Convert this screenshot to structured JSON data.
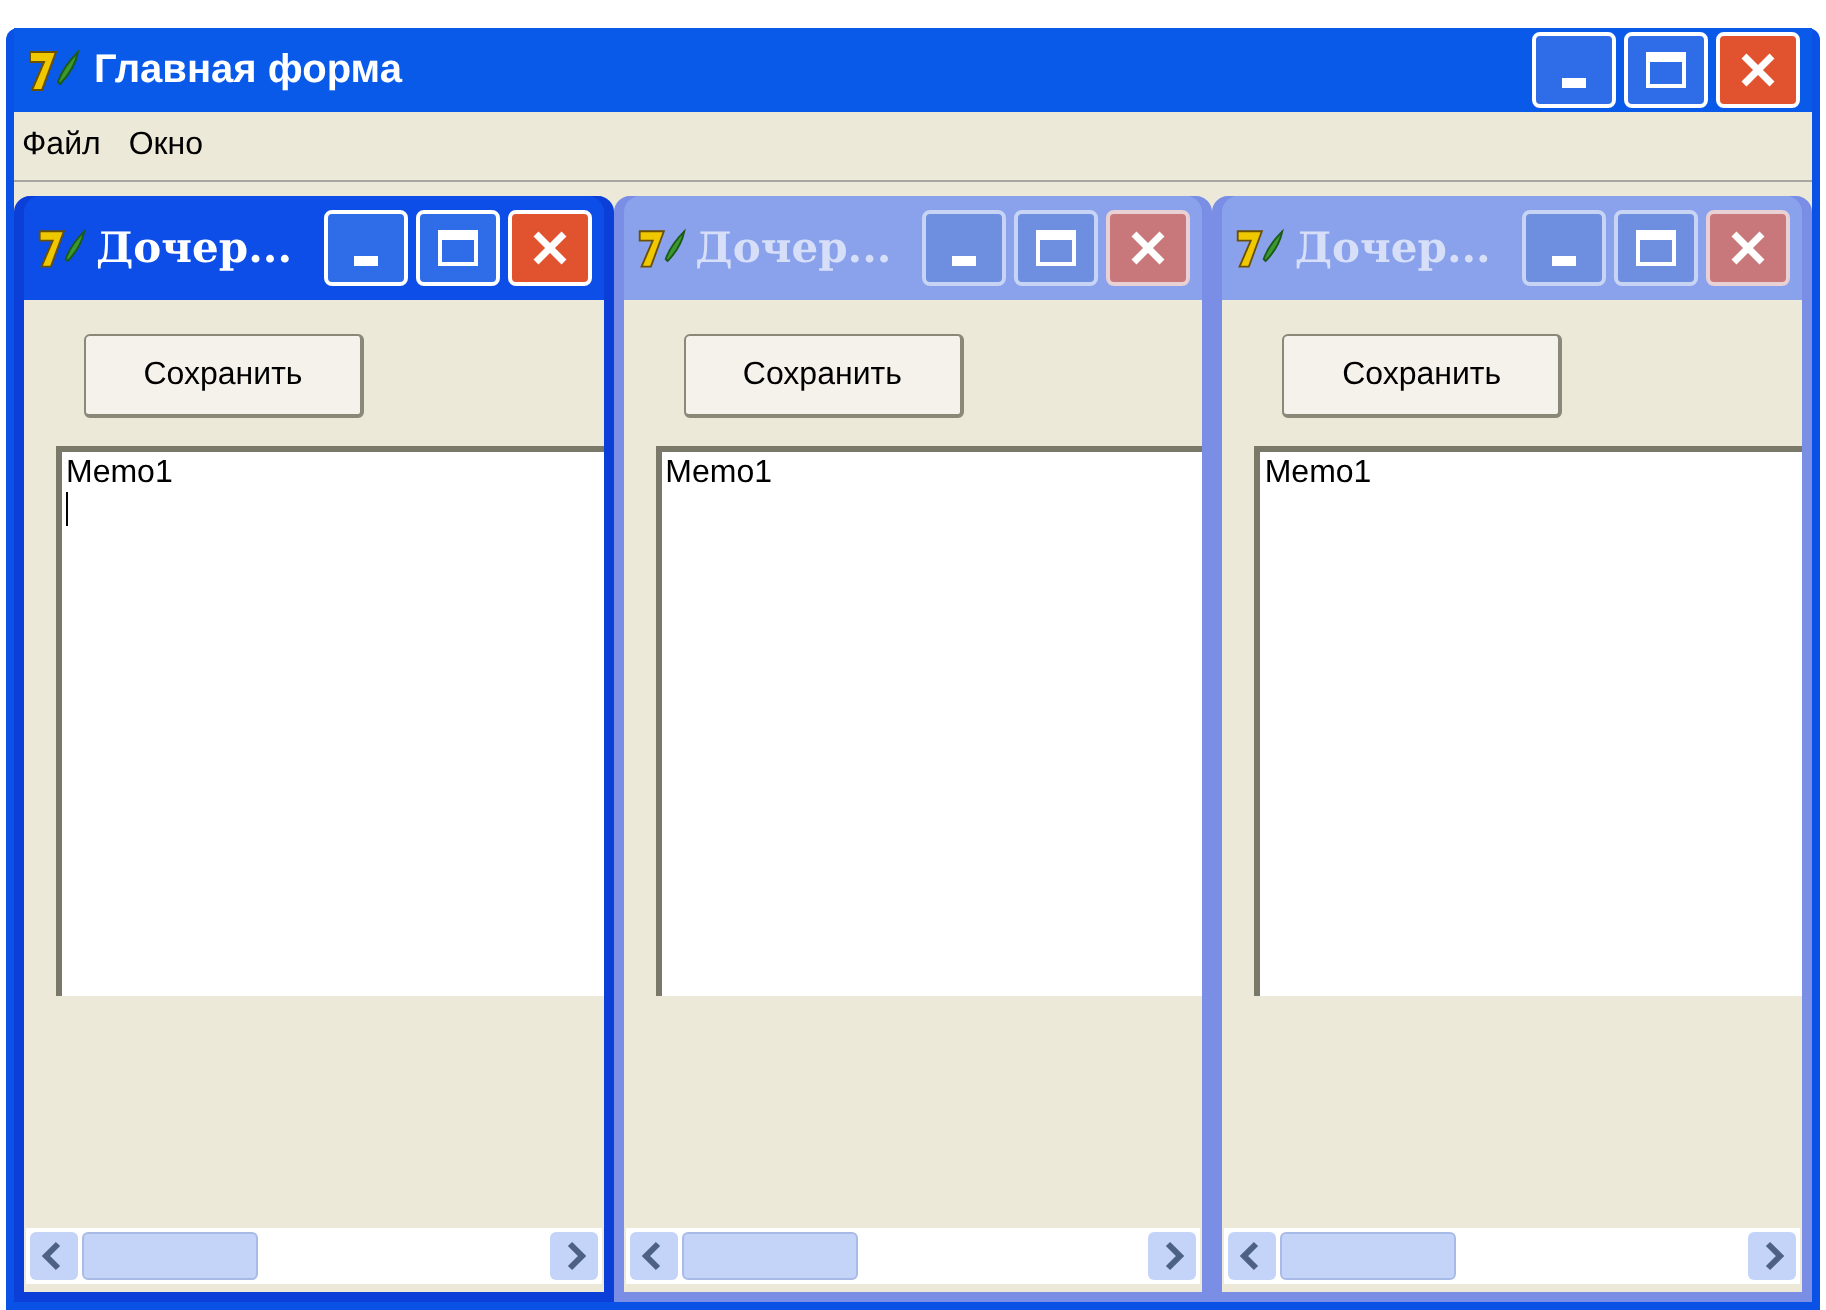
{
  "window": {
    "title": "Главная форма"
  },
  "menu": [
    "Файл",
    "Окно"
  ],
  "children": [
    {
      "title": "Дочер...",
      "active": true,
      "button": "Сохранить",
      "memo": "Memo1"
    },
    {
      "title": "Дочер...",
      "active": false,
      "button": "Сохранить",
      "memo": "Memo1"
    },
    {
      "title": "Дочер...",
      "active": false,
      "button": "Сохранить",
      "memo": "Memo1"
    }
  ]
}
